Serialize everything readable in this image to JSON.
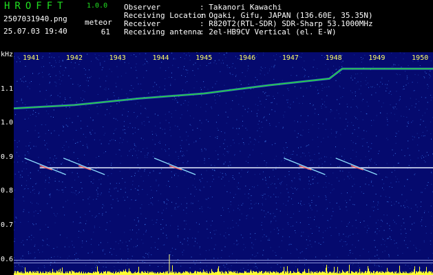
{
  "app": {
    "logo": "HROFFT",
    "version": "1.0.0",
    "filename": "2507031940.png",
    "datetime": "25.07.03 19:40",
    "meteor_label": "meteor",
    "meteor_count": "61"
  },
  "info": [
    {
      "label": "Observer",
      "value": ": Takanori Kawachi"
    },
    {
      "label": "Receiving Location",
      "value": ": Ogaki, Gifu, JAPAN (136.60E, 35.35N)"
    },
    {
      "label": "Receiver",
      "value": ": R820T2(RTL-SDR) SDR-Sharp 53.1000MHz"
    },
    {
      "label": "Receiving antenna",
      "value": ": 2el-HB9CV Vertical (el. E-W)"
    }
  ],
  "y_unit": "kHz",
  "y_ticks": [
    "1.1",
    "1.0",
    "0.9",
    "0.8",
    "0.7",
    "0.6"
  ],
  "time_ticks": [
    "1941",
    "1942",
    "1943",
    "1944",
    "1945",
    "1946",
    "1947",
    "1948",
    "1949",
    "1950"
  ],
  "colors": {
    "background": "#050a6e",
    "signal_green": "#21e021",
    "time_tick": "#ffff66",
    "activity_bar": "#ffff33",
    "carrier_line": "#e6f0ff"
  },
  "chart_data": {
    "type": "heatmap",
    "x_unit": "minute",
    "x_range": [
      1940.6,
      1950.3
    ],
    "y_unit": "kHz",
    "ylim": [
      0.575,
      1.25
    ],
    "carrier_khz": 0.9,
    "drifting_trace_khz": [
      {
        "t": 1940.6,
        "f": 1.08
      },
      {
        "t": 1942.0,
        "f": 1.09
      },
      {
        "t": 1943.5,
        "f": 1.11
      },
      {
        "t": 1945.0,
        "f": 1.125
      },
      {
        "t": 1946.5,
        "f": 1.15
      },
      {
        "t": 1947.9,
        "f": 1.17
      },
      {
        "t": 1948.2,
        "f": 1.2
      },
      {
        "t": 1950.3,
        "f": 1.2
      }
    ],
    "meteor_echo_times": [
      1941.2,
      1942.1,
      1944.2,
      1947.2,
      1948.4
    ]
  }
}
